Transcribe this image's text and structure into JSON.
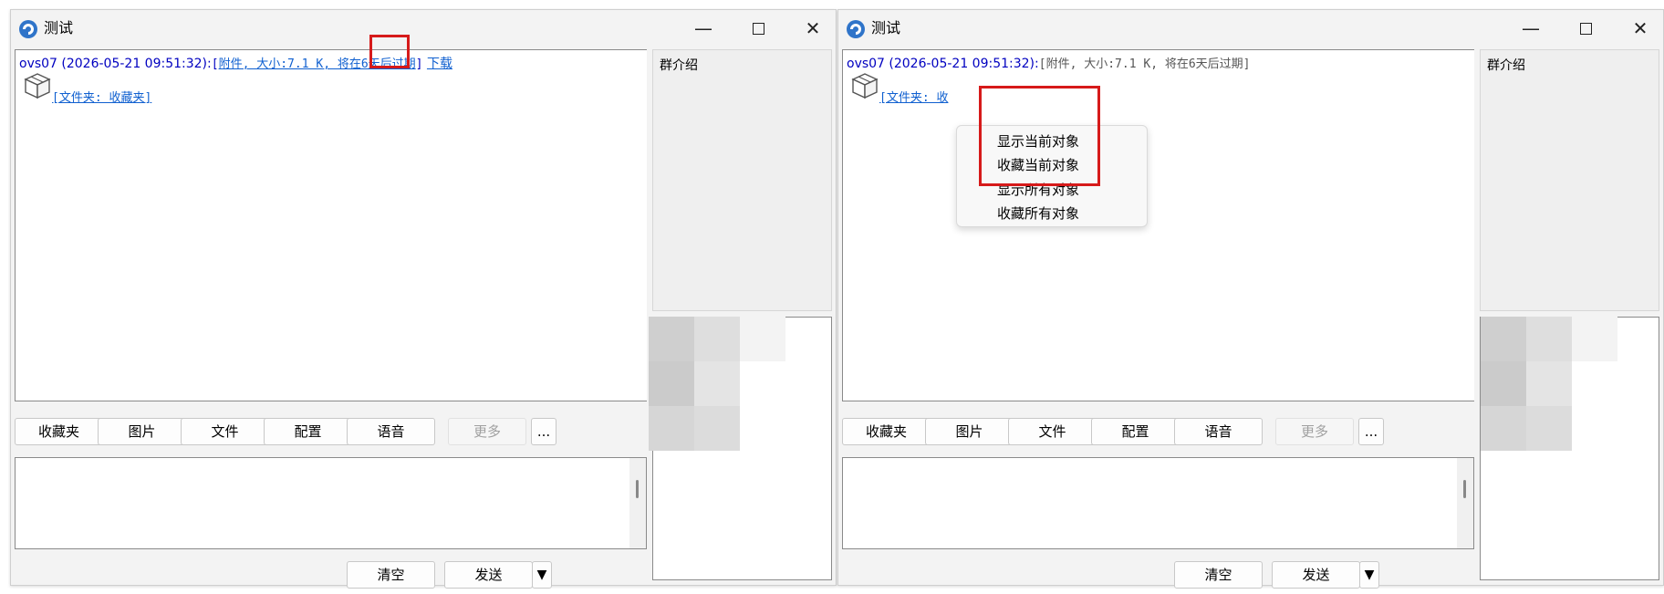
{
  "windows": [
    {
      "title": "测试",
      "message": {
        "sender": "ovs07 (2026-05-21 09:51:32):",
        "attachment_open": "[",
        "attachment_text": "附件, 大小:7.1 K, 将在6天后过期",
        "attachment_close": "]",
        "download": "下载",
        "folder_link": "[文件夹: 收藏夹]"
      },
      "toolbar": [
        "收藏夹",
        "图片",
        "文件",
        "配置",
        "语音",
        "更多",
        "..."
      ],
      "clear": "清空",
      "send": "发送",
      "send_menu_arrow": "▼",
      "intro_label": "群介绍"
    },
    {
      "title": "测试",
      "message": {
        "sender": "ovs07 (2026-05-21 09:51:32):",
        "attachment_open": "[",
        "attachment_text": "附件, 大小:7.1 K, 将在6天后过期",
        "attachment_close": "]",
        "folder_link": "[文件夹: 收"
      },
      "context_menu": [
        "显示当前对象",
        "收藏当前对象",
        "显示所有对象",
        "收藏所有对象"
      ],
      "toolbar": [
        "收藏夹",
        "图片",
        "文件",
        "配置",
        "语音",
        "更多",
        "..."
      ],
      "clear": "清空",
      "send": "发送",
      "send_menu_arrow": "▼",
      "intro_label": "群介绍"
    }
  ],
  "titlebar_controls": {
    "minimize": "—",
    "maximize": "☐",
    "close": "✕"
  },
  "colors": {
    "sender_blue": "#0000c0",
    "link_blue": "#1060d0",
    "highlight_red": "#d61a1a",
    "window_bg": "#f3f3f3"
  },
  "icons": [
    "app-logo-icon",
    "package-box-icon",
    "minimize-icon",
    "maximize-icon",
    "close-icon",
    "dropdown-arrow-icon"
  ]
}
